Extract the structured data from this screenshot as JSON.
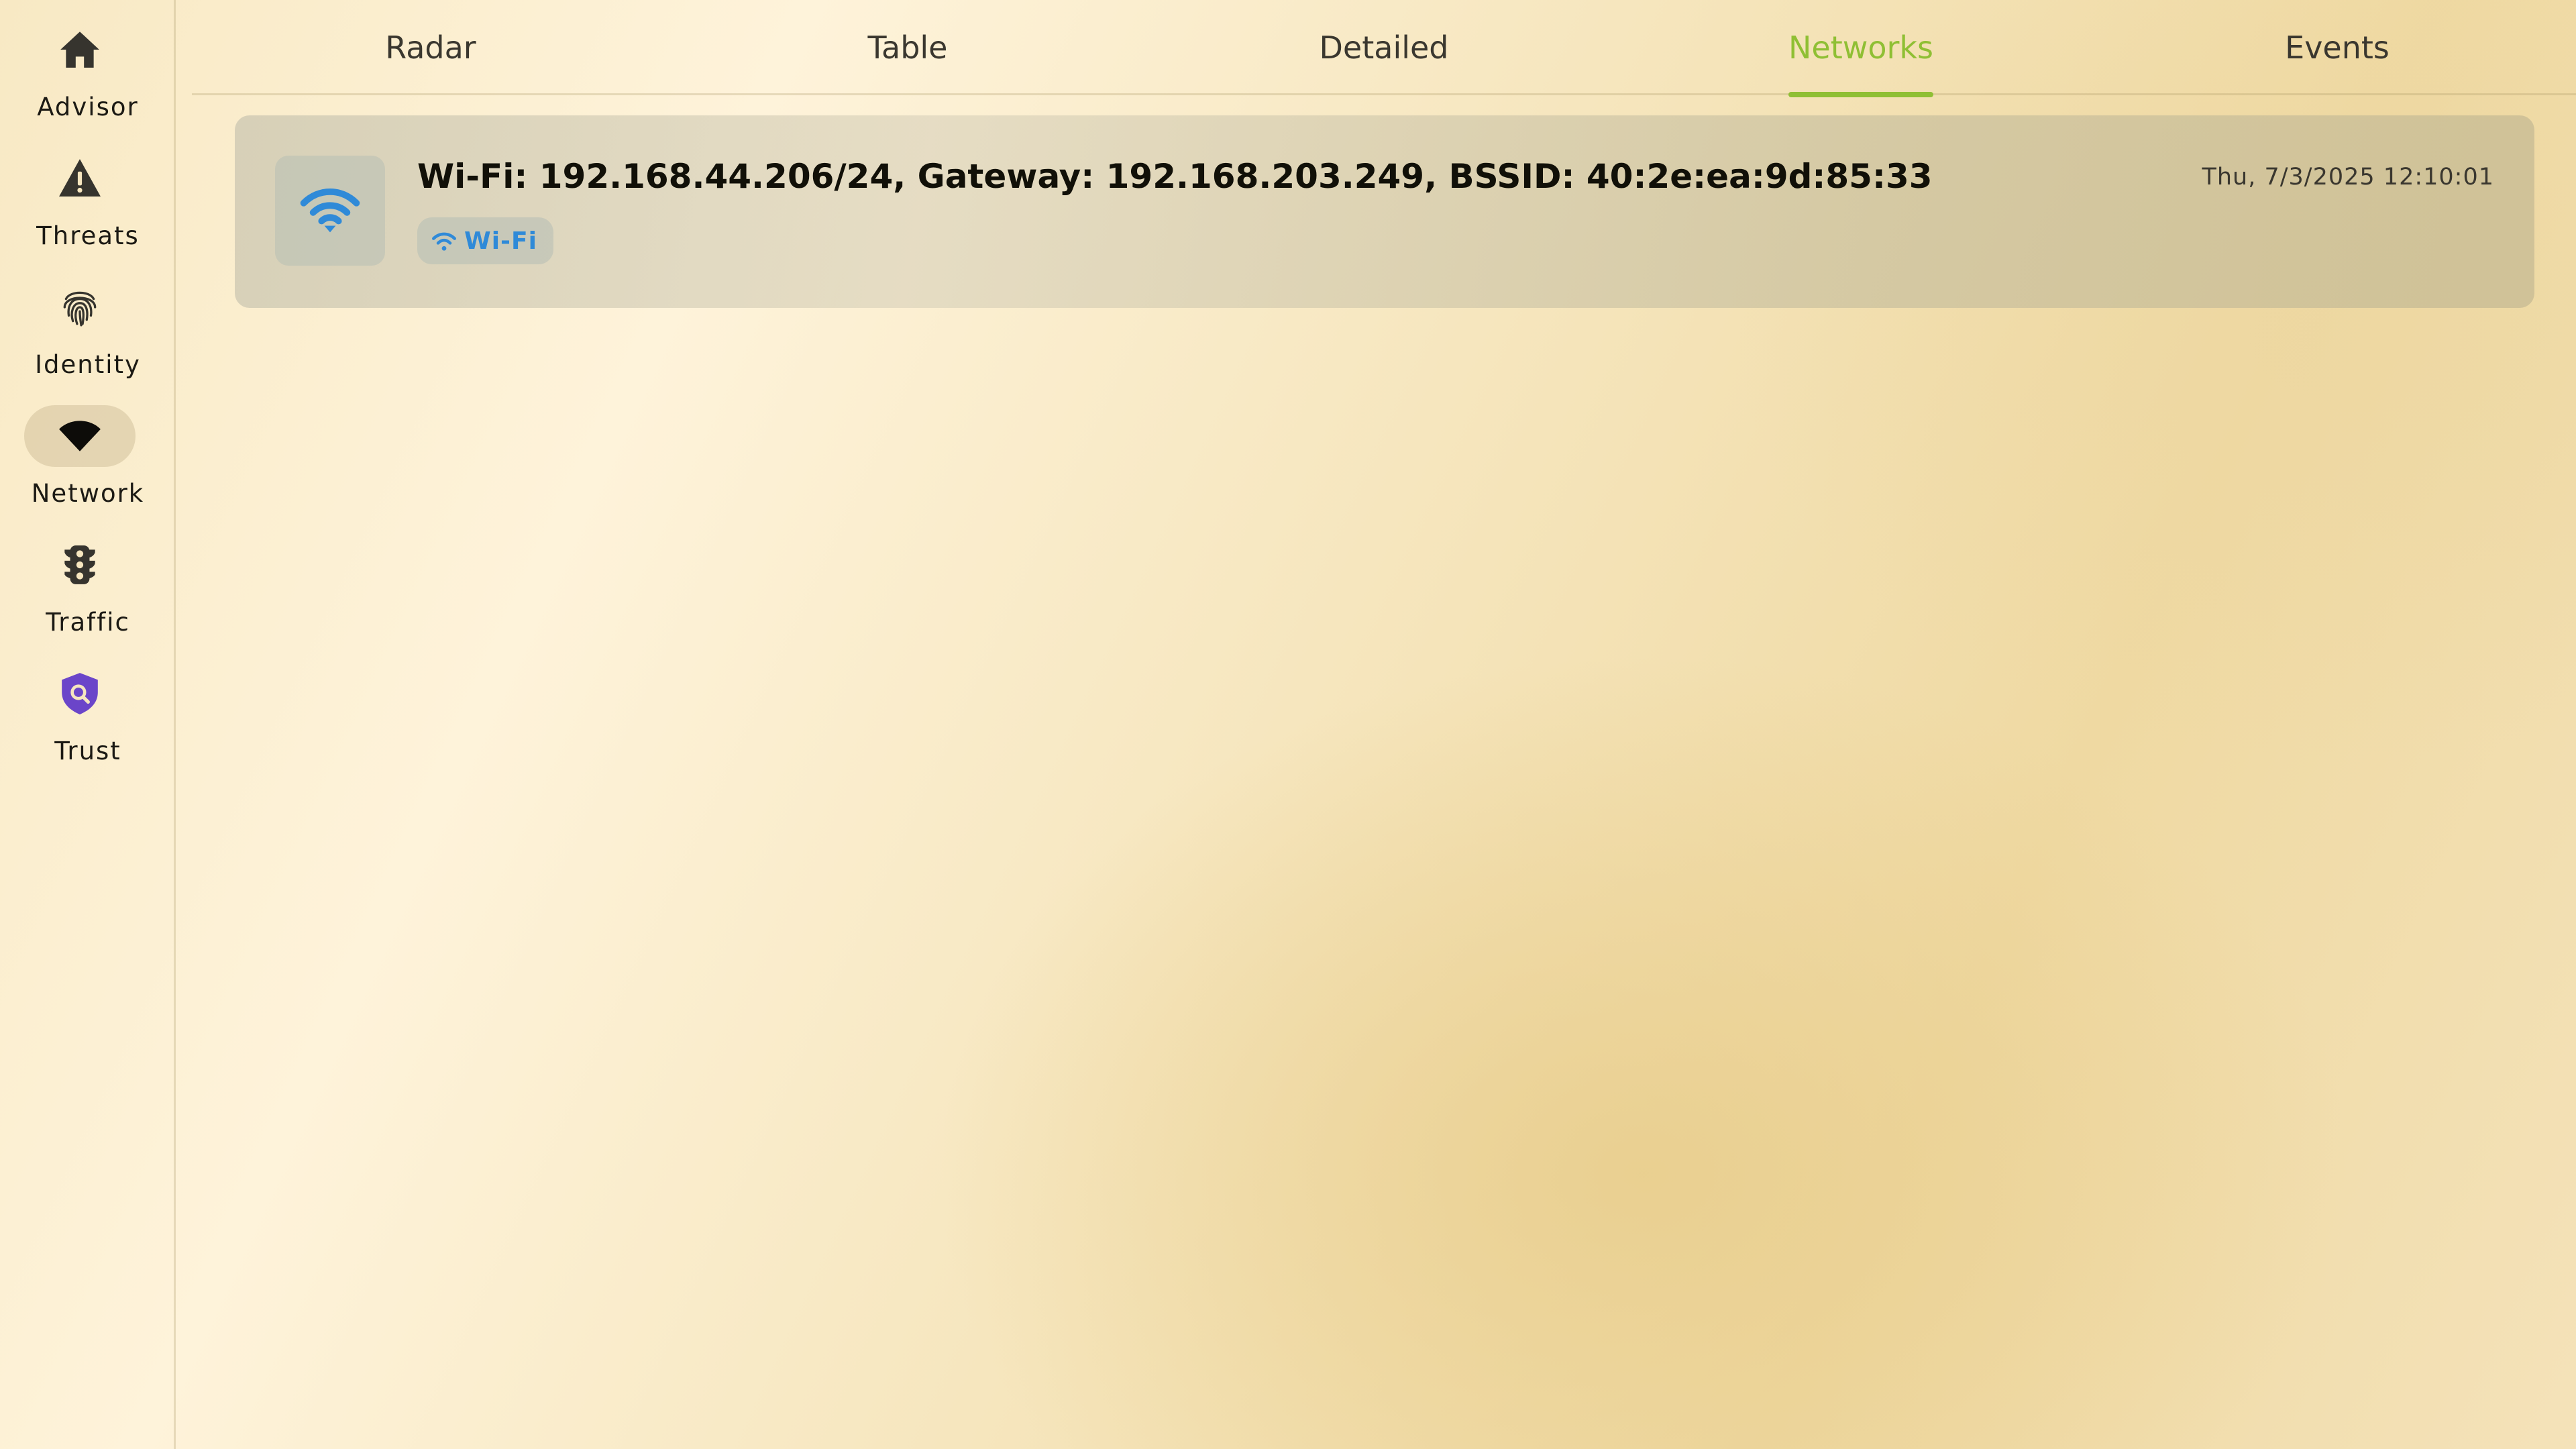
{
  "sidebar": {
    "items": [
      {
        "label": "Advisor",
        "icon": "home-icon"
      },
      {
        "label": "Threats",
        "icon": "warning-triangle-icon"
      },
      {
        "label": "Identity",
        "icon": "fingerprint-icon"
      },
      {
        "label": "Network",
        "icon": "wifi-icon",
        "active": true
      },
      {
        "label": "Traffic",
        "icon": "traffic-light-icon"
      },
      {
        "label": "Trust",
        "icon": "shield-search-icon",
        "color": "#6b45c9"
      }
    ]
  },
  "tabs": [
    {
      "label": "Radar"
    },
    {
      "label": "Table"
    },
    {
      "label": "Detailed"
    },
    {
      "label": "Networks",
      "active": true
    },
    {
      "label": "Events"
    }
  ],
  "colors": {
    "accent_green": "#8fbf34",
    "wifi_blue": "#2f8ad8",
    "trust_purple": "#6b45c9"
  },
  "networks": [
    {
      "title": "Wi-Fi: 192.168.44.206/24, Gateway: 192.168.203.249, BSSID: 40:2e:ea:9d:85:33",
      "badge": "Wi-Fi",
      "badge_icon": "wifi-icon",
      "icon": "wifi-icon",
      "timestamp": "Thu, 7/3/2025 12:10:01"
    }
  ]
}
